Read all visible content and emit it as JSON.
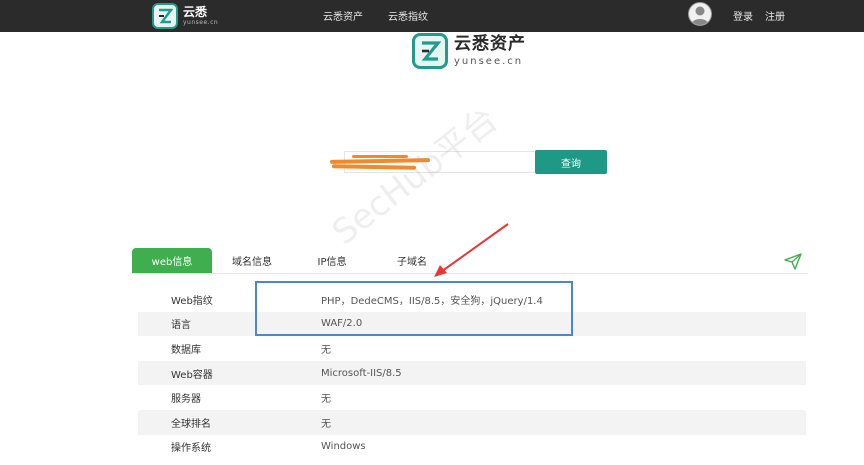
{
  "topbar": {
    "logo_title": "云悉",
    "logo_domain": "yunsee.cn",
    "nav": [
      {
        "label": "云悉资产"
      },
      {
        "label": "云悉指纹"
      }
    ],
    "login_label": "登录",
    "register_label": "注册"
  },
  "hero": {
    "title": "云悉资产",
    "domain": "yunsee.cn"
  },
  "search": {
    "button_label": "查询"
  },
  "watermark": "SecHub平台",
  "tabs": [
    {
      "label": "web信息",
      "active": true
    },
    {
      "label": "域名信息",
      "active": false
    },
    {
      "label": "IP信息",
      "active": false
    },
    {
      "label": "子域名",
      "active": false
    }
  ],
  "info_rows": [
    {
      "label": "Web指纹",
      "value": "PHP，DedeCMS，IIS/8.5，安全狗，jQuery/1.4"
    },
    {
      "label": "语言",
      "value": "WAF/2.0"
    },
    {
      "label": "数据库",
      "value": "无"
    },
    {
      "label": "Web容器",
      "value": "Microsoft-IIS/8.5"
    },
    {
      "label": "服务器",
      "value": "无"
    },
    {
      "label": "全球排名",
      "value": "无"
    },
    {
      "label": "操作系统",
      "value": "Windows"
    }
  ],
  "colors": {
    "topbar": "#2b2b2b",
    "brand": "#1e9985",
    "tab_active": "#3fae4f",
    "highlight": "#4a86d8",
    "annotation_arrow": "#e53935",
    "redaction": "#f08a2a"
  },
  "icons": {
    "logo": "yunsee-logo-icon",
    "avatar": "user-avatar-icon",
    "share": "paper-plane-icon"
  }
}
